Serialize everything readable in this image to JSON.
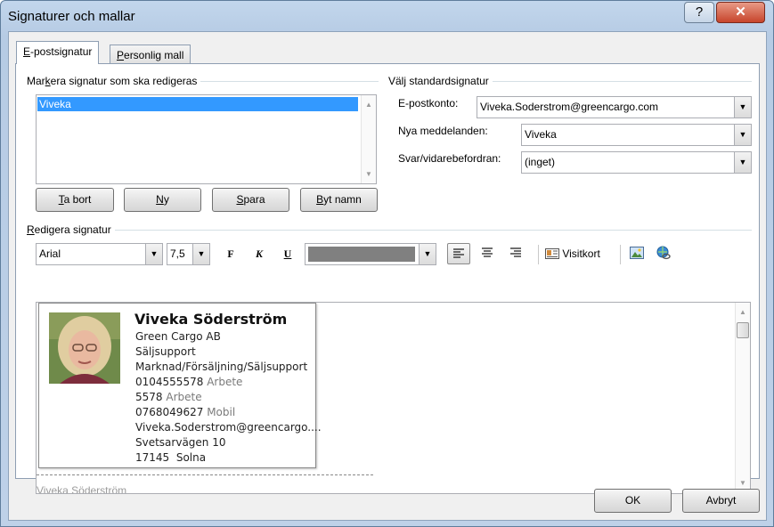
{
  "window": {
    "title": "Signaturer och mallar",
    "help_label": "?",
    "close_label": "✕"
  },
  "tabs": [
    {
      "label_pre": "",
      "label_key": "E",
      "label_post": "-postsignatur"
    },
    {
      "label_pre": "",
      "label_key": "P",
      "label_post": "ersonlig mall"
    }
  ],
  "edit_group": {
    "label_pre": "Mar",
    "label_key": "k",
    "label_post": "era signatur som ska redigeras"
  },
  "signatures": [
    "Viveka"
  ],
  "buttons": {
    "delete": {
      "key": "T",
      "rest": "a bort"
    },
    "new": {
      "key": "N",
      "rest": "y"
    },
    "save": {
      "key": "S",
      "rest": "para"
    },
    "rename": {
      "key": "B",
      "rest": "yt namn"
    }
  },
  "default_group": {
    "label": "Välj standardsignatur",
    "account_label": "E-postkonto:",
    "account_value": "Viveka.Soderstrom@greencargo.com",
    "new_messages_label": "Nya meddelanden:",
    "new_messages_value": "Viveka",
    "replies_label": "Svar/vidarebefordran:",
    "replies_value": "(inget)"
  },
  "edit_signature": {
    "label_key": "R",
    "label_rest": "edigera signatur"
  },
  "toolbar": {
    "font": "Arial",
    "size": "7,5",
    "bold": "F",
    "italic": "K",
    "underline": "U",
    "vcard_label": "Visitkort",
    "color_swatch": "#808080"
  },
  "card": {
    "name": "Viveka Söderström",
    "company": "Green Cargo AB",
    "title": "Säljsupport",
    "department": "Marknad/Försäljning/Säljsupport",
    "phone1": "0104555578",
    "phone1_type": "Arbete",
    "phone2": "5578",
    "phone2_type": "Arbete",
    "phone3": "0768049627",
    "phone3_type": "Mobil",
    "email": "Viveka.Soderstrom@greencargo....",
    "street": "Svetsarvägen 10",
    "postal": "17145",
    "city": "Solna"
  },
  "editor_name": "Viveka Söderström",
  "footer": {
    "ok": "OK",
    "cancel": "Avbryt"
  }
}
